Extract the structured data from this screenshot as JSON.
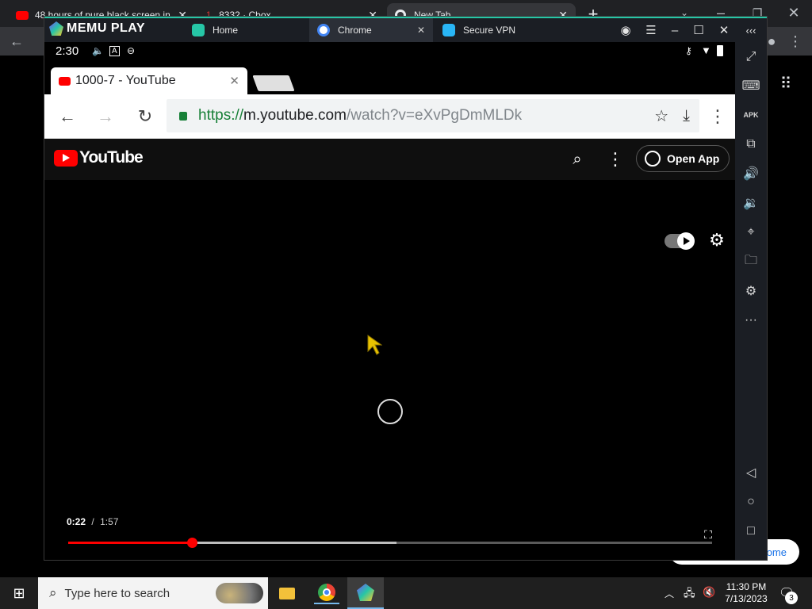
{
  "host_browser": {
    "tabs": [
      {
        "title": "48 hours of pure black screen in",
        "favicon": "youtube-icon"
      },
      {
        "title": "8332 · Cbox",
        "favicon": "cbox-icon"
      },
      {
        "title": "New Tab",
        "favicon": "chrome-icon"
      }
    ],
    "behind_pill_text": "ome"
  },
  "memu": {
    "brand": "MEMU PLAY",
    "tabs": [
      {
        "label": "Home",
        "icon": "memu-home-icon"
      },
      {
        "label": "Chrome",
        "icon": "chrome-icon"
      },
      {
        "label": "Secure VPN",
        "icon": "vpn-icon"
      }
    ],
    "sidebar_icons": [
      "fullscreen-icon",
      "keyboard-icon",
      "apk-icon",
      "multi-window-icon",
      "volume-up-icon",
      "volume-down-icon",
      "location-icon",
      "folder-icon",
      "settings-icon",
      "more-icon",
      "back-triangle-icon",
      "home-circle-icon",
      "recents-square-icon"
    ]
  },
  "android": {
    "status": {
      "time": "2:30"
    },
    "chrome": {
      "tab_title": "1000-7 - YouTube",
      "url_scheme": "https://",
      "url_host": "m.youtube.com",
      "url_path": "/watch?v=eXvPgDmMLDk"
    },
    "youtube": {
      "logo_text": "YouTube",
      "open_app_label": "Open App",
      "current_time": "0:22",
      "separator": "/",
      "duration": "1:57",
      "progress_fraction": 0.192,
      "buffered_fraction": 0.51
    }
  },
  "taskbar": {
    "search_placeholder": "Type here to search",
    "clock_time": "11:30 PM",
    "clock_date": "7/13/2023",
    "notification_count": "3"
  },
  "colors": {
    "memu_accent": "#26c6a6",
    "yt_red": "#ff0000"
  }
}
